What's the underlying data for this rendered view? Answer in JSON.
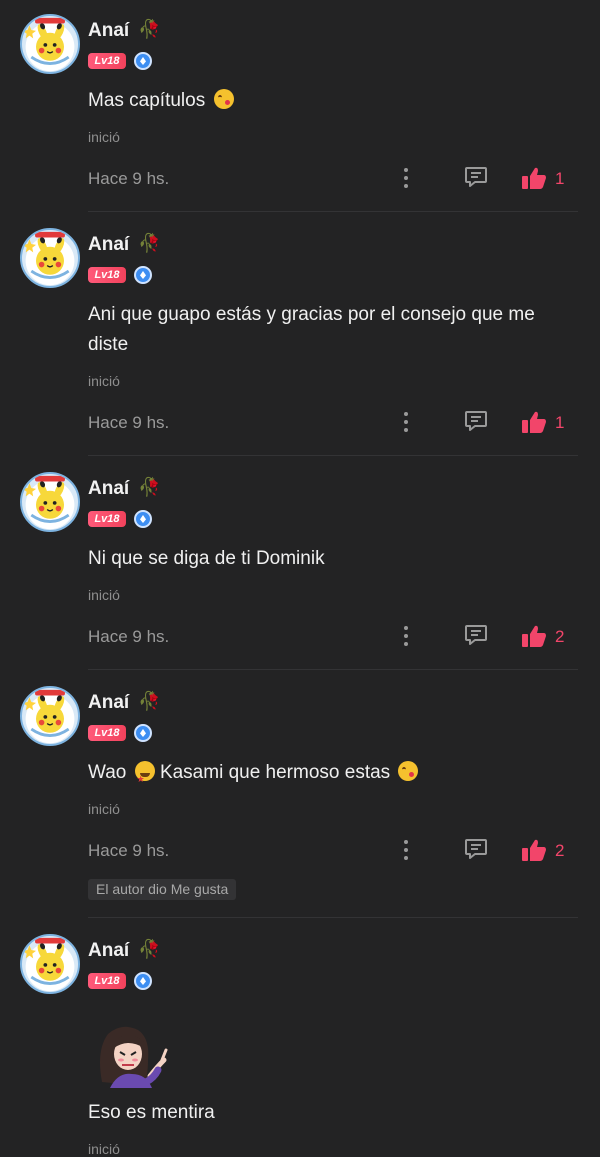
{
  "comments": [
    {
      "username": "Anaí",
      "level": "Lv18",
      "text": "Mas capítulos",
      "status": "inició",
      "time": "Hace 9 hs.",
      "likes": "1"
    },
    {
      "username": "Anaí",
      "level": "Lv18",
      "text": "Ani que guapo estás y gracias por el consejo que me diste",
      "status": "inició",
      "time": "Hace 9 hs.",
      "likes": "1"
    },
    {
      "username": "Anaí",
      "level": "Lv18",
      "text": "Ni que se diga de ti Dominik",
      "status": "inició",
      "time": "Hace 9 hs.",
      "likes": "2"
    },
    {
      "username": "Anaí",
      "level": "Lv18",
      "text_before": "Wao",
      "text_after": "Kasami que hermoso estas",
      "status": "inició",
      "time": "Hace 9 hs.",
      "likes": "2",
      "author_liked": "El autor dio Me gusta"
    },
    {
      "username": "Anaí",
      "level": "Lv18",
      "text": "Eso es mentira",
      "status": "inició"
    }
  ],
  "icons": {
    "more": "more-vertical-icon",
    "reply": "comment-icon",
    "like": "thumbs-up-icon",
    "verified": "verified-badge-icon",
    "rose": "rose-icon"
  },
  "colors": {
    "background": "#232324",
    "accent": "#f2456a",
    "level_badge": "#f2425c",
    "verified": "#3d8ef2"
  }
}
